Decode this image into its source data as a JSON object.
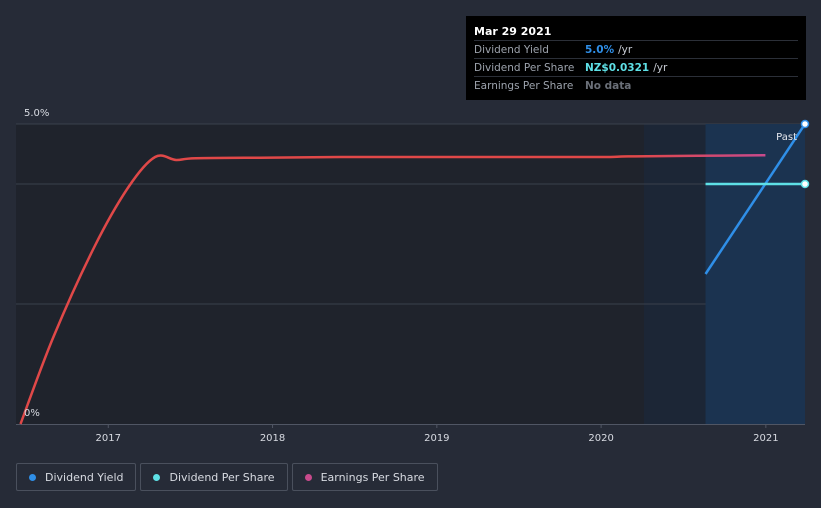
{
  "chart_data": {
    "type": "line",
    "x_ticks": [
      "2017",
      "2018",
      "2019",
      "2020",
      "2021"
    ],
    "y_ticks": [
      "5.0%",
      "0%"
    ],
    "ylim": [
      0,
      5.0
    ],
    "y_unit": "%",
    "grid": true,
    "forecast_label": "Past",
    "legend_position": "bottom-left",
    "series": [
      {
        "name": "Dividend Yield",
        "color": "#2f8fe8",
        "x": [
          "2020-08-20",
          "2021-03-29"
        ],
        "y": [
          2.5,
          5.0
        ]
      },
      {
        "name": "Dividend Per Share",
        "color": "#5ee0e6",
        "x": [
          "2020-08-20",
          "2021-03-29"
        ],
        "y": [
          4.0,
          4.0
        ]
      },
      {
        "name": "Earnings Per Share",
        "color": "#e04848",
        "x": [
          "2016-06-20",
          "2016-09-01",
          "2016-12-01",
          "2017-02-15",
          "2017-04-15",
          "2017-06-01",
          "2017-07-15",
          "2018-01-01",
          "2018-06-01",
          "2019-01-01",
          "2019-06-01",
          "2020-01-01",
          "2020-03-01",
          "2020-08-01",
          "2020-12-31"
        ],
        "y": [
          0.0,
          1.45,
          2.95,
          3.95,
          4.45,
          4.4,
          4.43,
          4.44,
          4.45,
          4.45,
          4.45,
          4.45,
          4.46,
          4.47,
          4.48
        ]
      }
    ]
  },
  "tooltip": {
    "date": "Mar 29 2021",
    "rows": [
      {
        "label": "Dividend Yield",
        "value": "5.0%",
        "unit": "/yr",
        "color": "#2f8fe8"
      },
      {
        "label": "Dividend Per Share",
        "value": "NZ$0.0321",
        "unit": "/yr",
        "color": "#5ee0e6"
      },
      {
        "label": "Earnings Per Share",
        "value": "No data",
        "unit": "",
        "color": "#6b7079"
      }
    ]
  },
  "legend": [
    {
      "label": "Dividend Yield",
      "color": "#2f8fe8"
    },
    {
      "label": "Dividend Per Share",
      "color": "#5ee0e6"
    },
    {
      "label": "Earnings Per Share",
      "color": "#c84a8c"
    }
  ]
}
